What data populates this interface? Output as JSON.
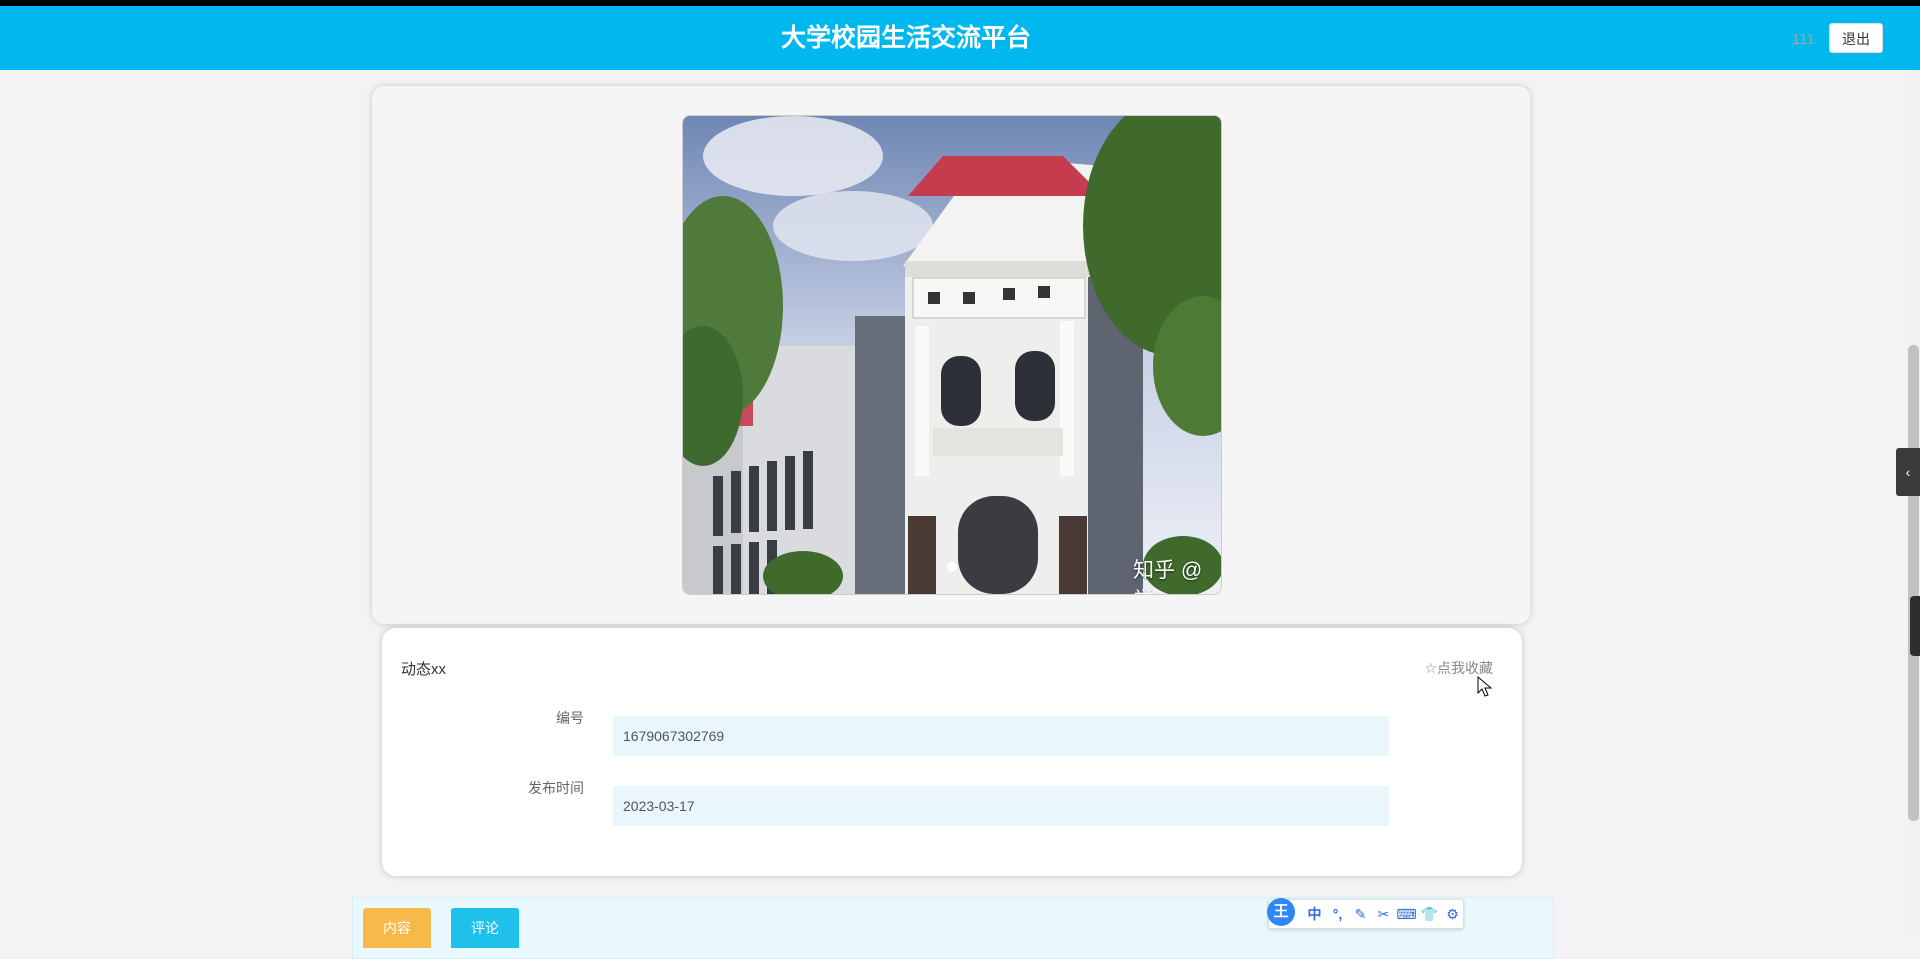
{
  "header": {
    "site_title": "大学校园生活交流平台",
    "user_name": "111",
    "logout_label": "退出"
  },
  "carousel": {
    "watermark": "知乎 @学"
  },
  "detail": {
    "title": "动态xx",
    "favorite_label": "☆点我收藏",
    "fields": [
      {
        "label": "编号",
        "value": "1679067302769"
      },
      {
        "label": "发布时间",
        "value": "2023-03-17"
      }
    ]
  },
  "tabs": {
    "content_label": "内容",
    "comments_label": "评论"
  },
  "ime_toolbar": {
    "logo": "王",
    "items": [
      "中",
      "°,",
      "✎",
      "✂",
      "⌨",
      "👕",
      "⚙"
    ]
  },
  "colors": {
    "header": "#00b7ee",
    "tab_content": "#f8b94b",
    "tab_comments": "#1dc1ea",
    "field_bg": "#e9f7fc"
  }
}
